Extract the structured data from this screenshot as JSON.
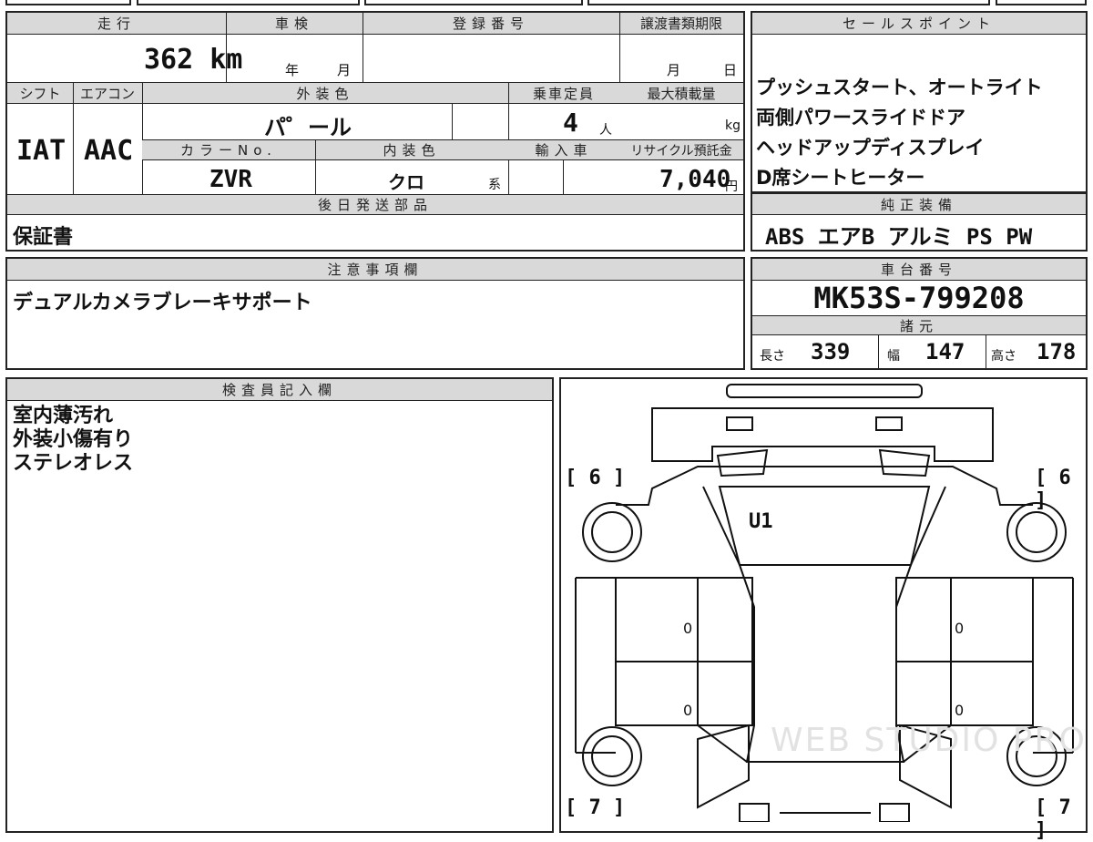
{
  "vehicle": {
    "mileage_label": "走行",
    "mileage": "362 km",
    "inspection_label": "車検",
    "inspection_year_unit": "年",
    "inspection_month_unit": "月",
    "registration_label": "登録番号",
    "transfer_deadline_label": "譲渡書類期限",
    "transfer_month_unit": "月",
    "transfer_day_unit": "日",
    "shift_label": "シフト",
    "shift": "IAT",
    "aircon_label": "エアコン",
    "aircon": "AAC",
    "exterior_color_label": "外装色",
    "exterior_color": "パ゜ール",
    "capacity_label": "乗車定員",
    "capacity": "4",
    "capacity_unit": "人",
    "max_load_label": "最大積載量",
    "max_load_unit": "kg",
    "color_no_label": "カラーNo.",
    "color_no": "ZVR",
    "interior_color_label": "内装色",
    "interior_color": "クロ",
    "interior_suffix": "系",
    "import_label": "輸入車",
    "recycle_label": "リサイクル預託金",
    "recycle_fee": "7,040",
    "recycle_unit": "円",
    "later_parts_label": "後日発送部品",
    "later_parts": "保証書"
  },
  "sales_points": {
    "label": "セールスポイント",
    "items": [
      "プッシュスタート、オートライト",
      "両側パワースライドドア",
      "ヘッドアップディスプレイ",
      "D席シートヒーター"
    ]
  },
  "equipment": {
    "label": "純正装備",
    "value": "ABS エアB アルミ PS PW"
  },
  "notes": {
    "label": "注意事項欄",
    "value": "デュアルカメラブレーキサポート"
  },
  "chassis": {
    "label": "車台番号",
    "value": "MK53S-799208"
  },
  "specs": {
    "label": "諸元",
    "length_label": "長さ",
    "length": "339",
    "width_label": "幅",
    "width": "147",
    "height_label": "高さ",
    "height": "178"
  },
  "inspector": {
    "label": "検査員記入欄",
    "lines": [
      "室内薄汚れ",
      "外装小傷有り",
      "ステレオレス"
    ]
  },
  "diagram": {
    "tire_front_left": "[ 6 ]",
    "tire_front_right": "[ 6 ]",
    "tire_rear_left": "[ 7 ]",
    "tire_rear_right": "[ 7 ]",
    "windshield_mark": "U1",
    "door_marks": [
      "0",
      "0",
      "0",
      "0"
    ],
    "watermark": "WEB STUDIO PRO"
  }
}
